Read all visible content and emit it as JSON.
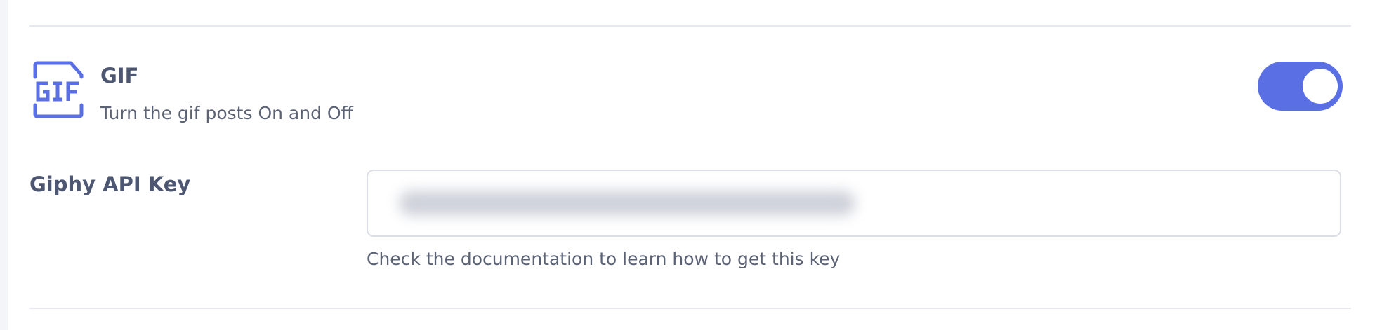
{
  "gif_section": {
    "icon": "gif-file-icon",
    "title": "GIF",
    "description": "Turn the gif posts On and Off",
    "enabled": true
  },
  "giphy_api_key": {
    "label": "Giphy API Key",
    "value": "",
    "obscured": true,
    "help_text": "Check the documentation to learn how to get this key"
  },
  "colors": {
    "accent": "#5a6fe3",
    "heading": "#4d5772",
    "text": "#5b6274",
    "divider": "#e7e9f0",
    "page_background": "#f4f5f9"
  }
}
